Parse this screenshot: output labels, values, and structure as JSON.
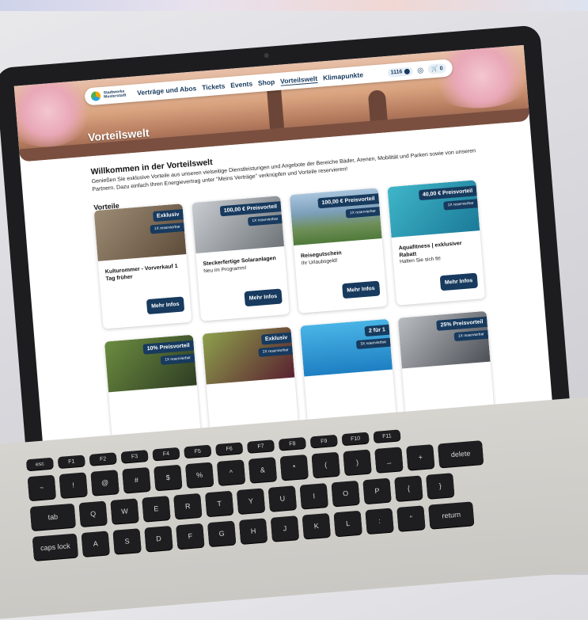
{
  "nav": {
    "logo_line1": "Stadtwerke",
    "logo_line2": "Musterstadt",
    "items": [
      "Verträge und Abos",
      "Tickets",
      "Events",
      "Shop",
      "Vorteilswelt",
      "Klimapunkte"
    ],
    "points": "1116",
    "cart_count": "0"
  },
  "hero": {
    "title": "Vorteilswelt"
  },
  "welcome": {
    "title": "Willkommen in der Vorteilswelt",
    "text": "Genießen Sie exklusive Vorteile aus unseren vielseitige Dienstleistungen und Angebote der Bereiche Bäder, Arenen, Mobilität und Parken sowie von unseren Partnern. Dazu einfach Ihren Energievertrag unter \"Meins Verträge\" verknüpfen und Vorteile reservieren!"
  },
  "section_title": "Vorteile",
  "cards": [
    {
      "badge": "Exklusiv",
      "reserve": "1X reservierbar",
      "title": "Kulturommer - Vorverkauf 1 Tag früher",
      "subtitle": "",
      "button": "Mehr Infos"
    },
    {
      "badge": "100,00 € Preisvorteil",
      "reserve": "1X reservierbar",
      "title": "Steckerfertige Solaranlagen",
      "subtitle": "Neu im Programm!",
      "button": "Mehr Infos"
    },
    {
      "badge": "100,00 € Preisvorteil",
      "reserve": "1X reservierbar",
      "title": "Reisegutschein",
      "subtitle": "Ihr Urlaubsgeld!",
      "button": "Mehr Infos"
    },
    {
      "badge": "40,00 € Preisvorteil",
      "reserve": "1X reservierbar",
      "title": "Aquafitness | exklusiver Rabatt",
      "subtitle": "Halten Sie sich fit!",
      "button": "Mehr Infos"
    },
    {
      "badge": "10% Preisvorteil",
      "reserve": "1X reservierbar",
      "title": "",
      "subtitle": "",
      "button": ""
    },
    {
      "badge": "Exklusiv",
      "reserve": "2X reservierbar",
      "title": "",
      "subtitle": "",
      "button": ""
    },
    {
      "badge": "2 für 1",
      "reserve": "3X reservierbar",
      "title": "",
      "subtitle": "",
      "button": ""
    },
    {
      "badge": "25% Preisvorteil",
      "reserve": "1X reservierbar",
      "title": "",
      "subtitle": "",
      "button": ""
    }
  ],
  "keyboard": {
    "fn_row": [
      "esc",
      "F1",
      "F2",
      "F3",
      "F4",
      "F5",
      "F6",
      "F7",
      "F8",
      "F9",
      "F10",
      "F11"
    ],
    "num_row": [
      "~",
      "!",
      "@",
      "#",
      "$",
      "%",
      "^",
      "&",
      "*",
      "(",
      ")",
      "_",
      "+",
      "delete"
    ],
    "q_row": [
      "tab",
      "Q",
      "W",
      "E",
      "R",
      "T",
      "Y",
      "U",
      "I",
      "O",
      "P",
      "{",
      "}"
    ],
    "a_row": [
      "caps lock",
      "A",
      "S",
      "D",
      "F",
      "G",
      "H",
      "J",
      "K",
      "L",
      ":",
      "\"",
      "return"
    ]
  }
}
